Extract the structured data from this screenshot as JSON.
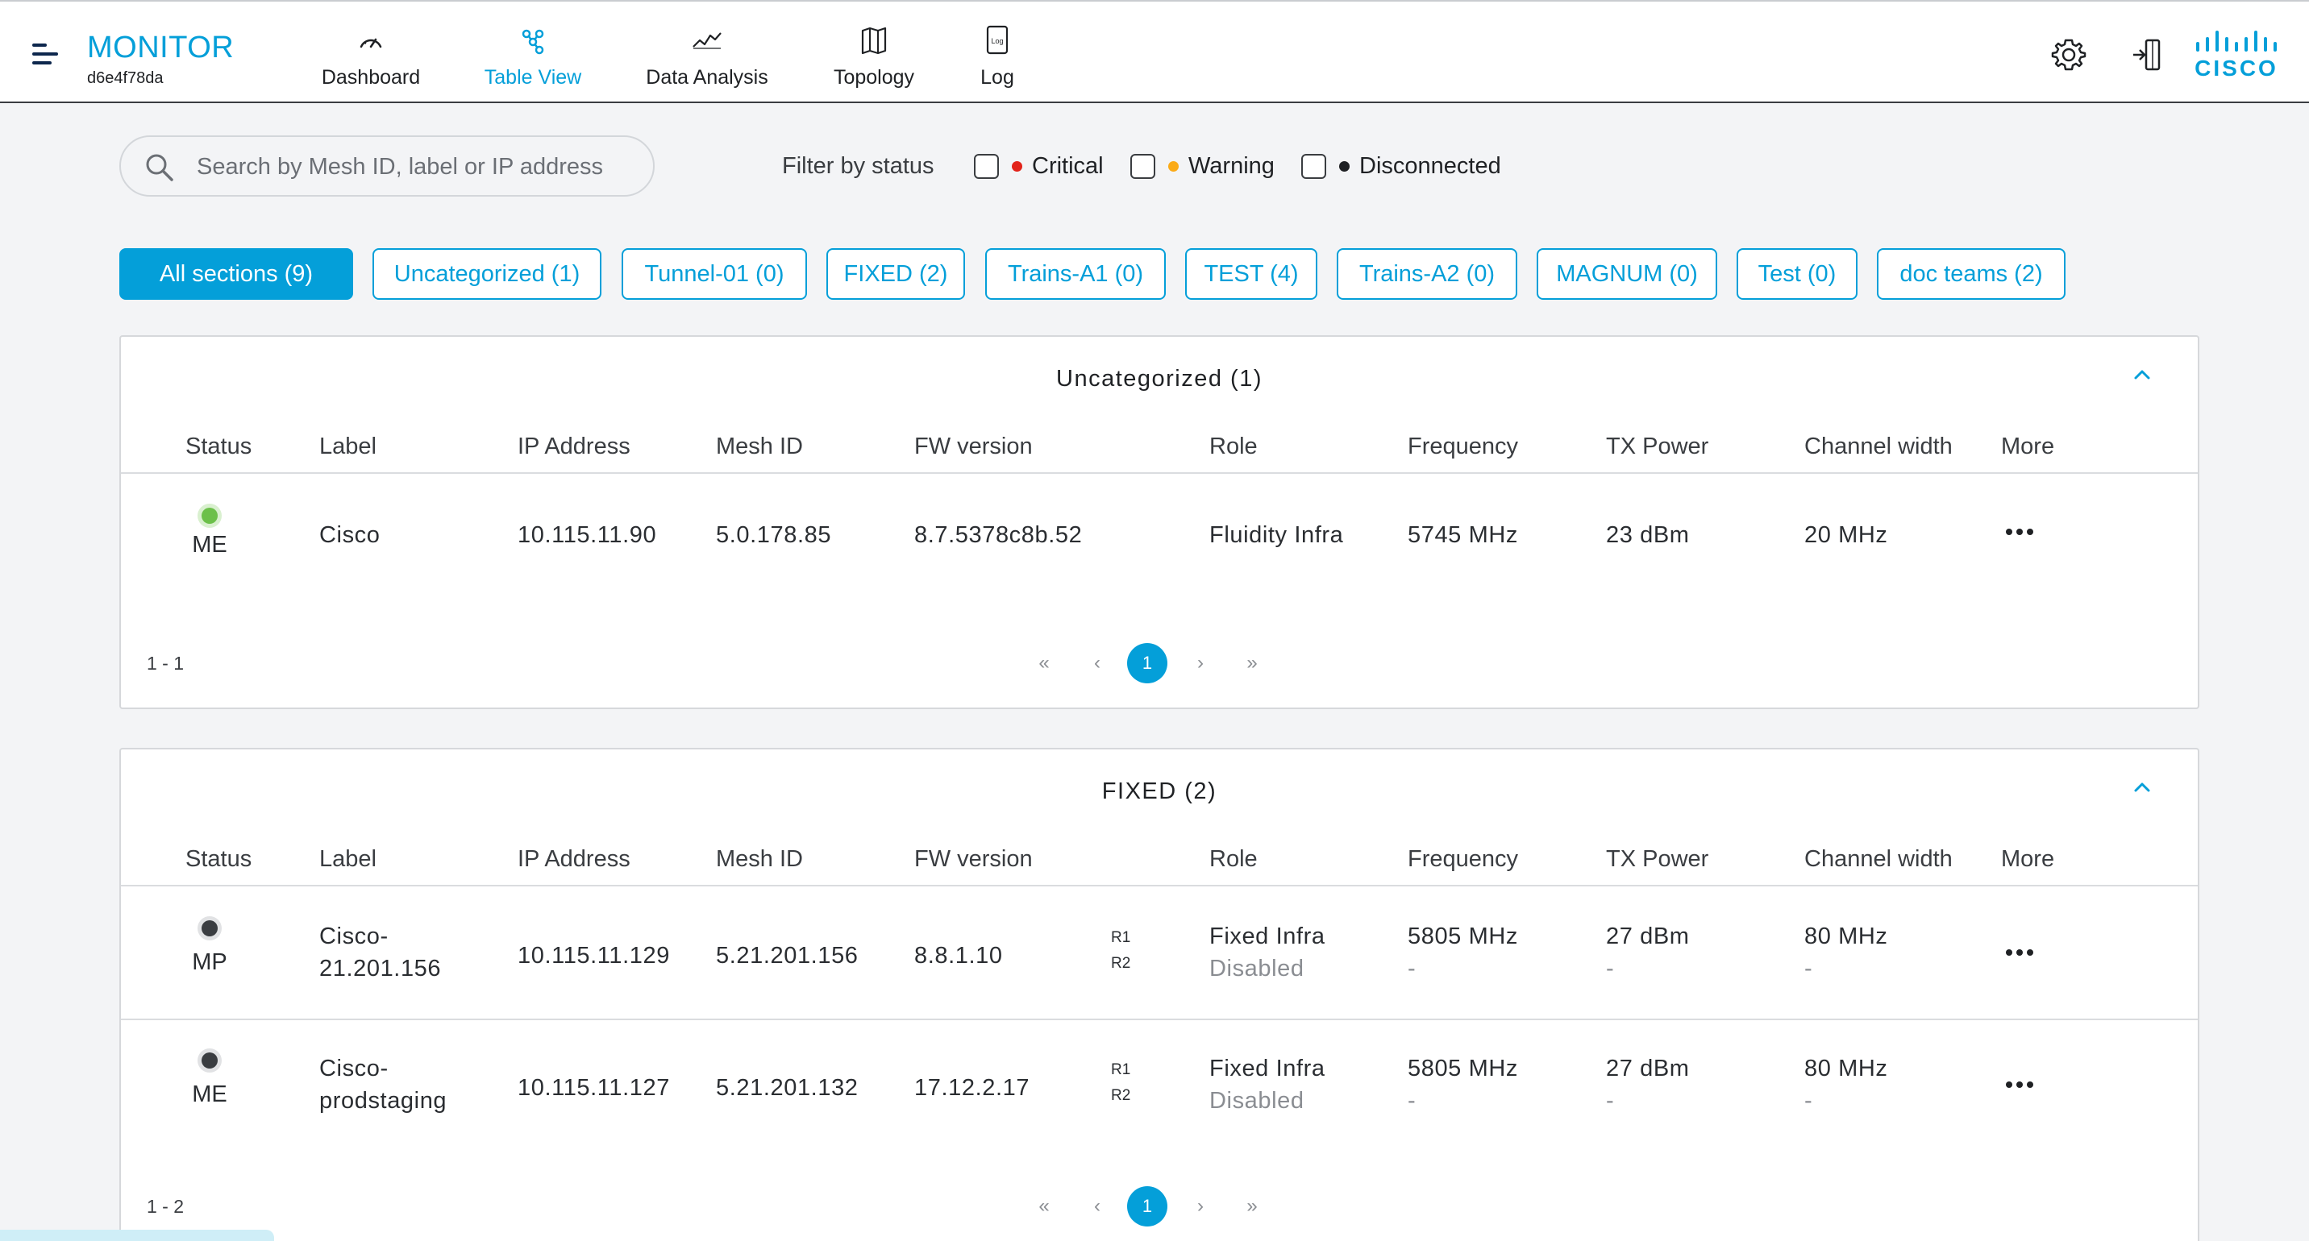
{
  "app": {
    "title": "MONITOR",
    "device_id": "d6e4f78da"
  },
  "nav": [
    {
      "label": "Dashboard",
      "icon": "gauge-icon",
      "active": false
    },
    {
      "label": "Table View",
      "icon": "network-nodes-icon",
      "active": true
    },
    {
      "label": "Data Analysis",
      "icon": "line-chart-icon",
      "active": false
    },
    {
      "label": "Topology",
      "icon": "map-icon",
      "active": false
    },
    {
      "label": "Log",
      "icon": "log-file-icon",
      "active": false
    }
  ],
  "header_actions": [
    "settings-gear-icon",
    "logout-icon",
    "cisco-logo"
  ],
  "brand": {
    "logo_text": "CISCO"
  },
  "search": {
    "placeholder": "Search by Mesh ID, label or IP address",
    "value": ""
  },
  "filters": {
    "label": "Filter by status",
    "options": [
      {
        "label": "Critical",
        "color": "#e2231a",
        "checked": false
      },
      {
        "label": "Warning",
        "color": "#fbab18",
        "checked": false
      },
      {
        "label": "Disconnected",
        "color": "#1f2124",
        "checked": false
      }
    ]
  },
  "section_chips": [
    {
      "label": "All sections (9)",
      "active": true
    },
    {
      "label": "Uncategorized (1)",
      "active": false
    },
    {
      "label": "Tunnel-01 (0)",
      "active": false
    },
    {
      "label": "FIXED (2)",
      "active": false
    },
    {
      "label": "Trains-A1 (0)",
      "active": false
    },
    {
      "label": "TEST (4)",
      "active": false
    },
    {
      "label": "Trains-A2 (0)",
      "active": false
    },
    {
      "label": "MAGNUM (0)",
      "active": false
    },
    {
      "label": "Test (0)",
      "active": false
    },
    {
      "label": "doc teams (2)",
      "active": false
    }
  ],
  "columns": [
    "Status",
    "Label",
    "IP Address",
    "Mesh ID",
    "FW version",
    "Role",
    "Frequency",
    "TX Power",
    "Channel width",
    "More"
  ],
  "sections": [
    {
      "title": "Uncategorized (1)",
      "range": "1 - 1",
      "current_page": "1",
      "rows": [
        {
          "status_color": "#6cc04a",
          "status_role": "ME",
          "label_lines": [
            "Cisco"
          ],
          "ip": "10.115.11.90",
          "mesh_id": "5.0.178.85",
          "fw": "8.7.5378c8b.52",
          "radios": [],
          "role": [
            "Fluidity Infra"
          ],
          "frequency": [
            "5745 MHz"
          ],
          "tx_power": [
            "23 dBm"
          ],
          "channel_width": [
            "20 MHz"
          ]
        }
      ]
    },
    {
      "title": "FIXED (2)",
      "range": "1 - 2",
      "current_page": "1",
      "rows": [
        {
          "status_color": "#3a3d41",
          "status_role": "MP",
          "label_lines": [
            "Cisco-",
            "21.201.156"
          ],
          "ip": "10.115.11.129",
          "mesh_id": "5.21.201.156",
          "fw": "8.8.1.10",
          "radios": [
            "R1",
            "R2"
          ],
          "role": [
            "Fixed Infra",
            "Disabled"
          ],
          "frequency": [
            "5805 MHz",
            "-"
          ],
          "tx_power": [
            "27 dBm",
            "-"
          ],
          "channel_width": [
            "80 MHz",
            "-"
          ]
        },
        {
          "status_color": "#3a3d41",
          "status_role": "ME",
          "label_lines": [
            "Cisco-",
            "prodstaging"
          ],
          "ip": "10.115.11.127",
          "mesh_id": "5.21.201.132",
          "fw": "17.12.2.17",
          "radios": [
            "R1",
            "R2"
          ],
          "role": [
            "Fixed Infra",
            "Disabled"
          ],
          "frequency": [
            "5805 MHz",
            "-"
          ],
          "tx_power": [
            "27 dBm",
            "-"
          ],
          "channel_width": [
            "80 MHz",
            "-"
          ]
        }
      ]
    }
  ]
}
